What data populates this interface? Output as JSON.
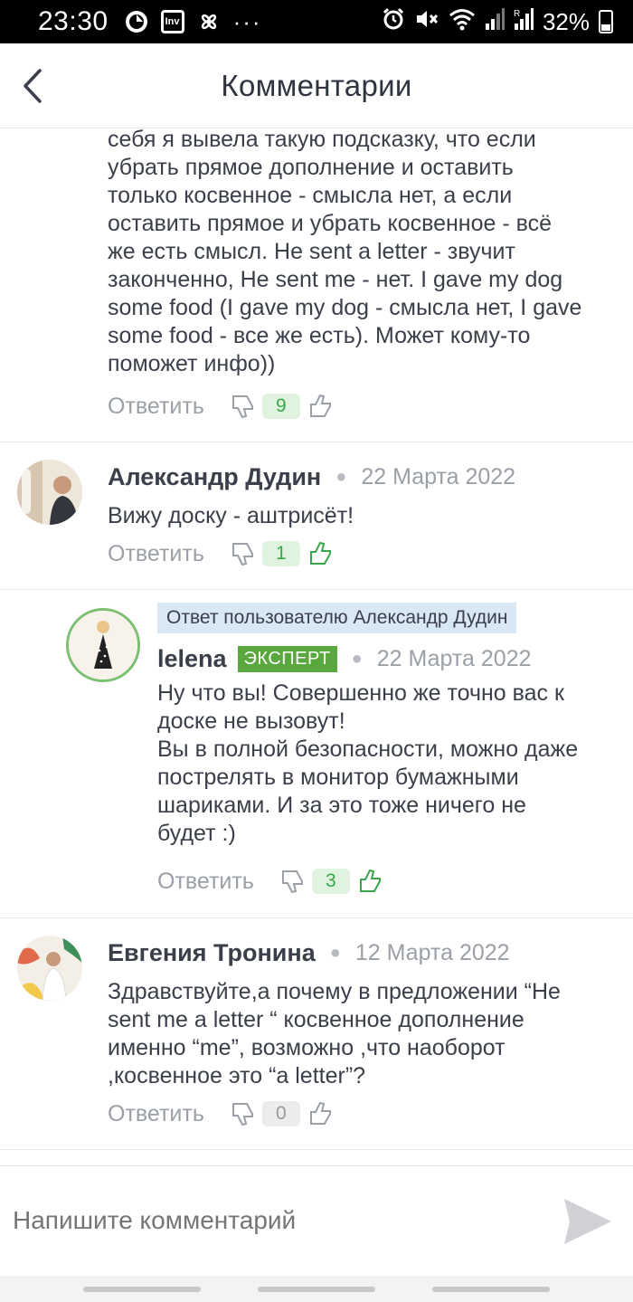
{
  "status_bar": {
    "time": "23:30",
    "battery": "32%",
    "icons_left": [
      "sync-icon",
      "inv-icon",
      "fan-icon",
      "more-icon"
    ],
    "icons_right": [
      "alarm-icon",
      "mute-icon",
      "wifi-icon",
      "signal-icon",
      "signal-roaming-icon",
      "battery-icon"
    ]
  },
  "header": {
    "title": "Комментарии",
    "back_icon": "chevron-left-icon"
  },
  "comments": [
    {
      "text": "себя я вывела такую подсказку, что если убрать прямое дополнение и оставить только косвенное - смысла нет, а если оставить прямое и убрать косвенное - всё же есть смысл. He sent a letter - звучит законченно, He sent me - нет. I gave my dog some food (I gave my dog - смысла нет, I gave some food - все же есть). Может кому-то поможет инфо))",
      "lines": [
        "себя я вывела такую подсказку, что если",
        "убрать прямое дополнение и оставить",
        "только косвенное - смысла нет, а если",
        "оставить прямое и убрать косвенное - всё",
        "же есть смысл. He sent a letter - звучит",
        "законченно, He sent me - нет. I gave my dog",
        "some food (I gave my dog - смысла нет, I gave",
        "some food - все же есть). Может кому-то",
        "поможет инфо))"
      ],
      "reply_label": "Ответить",
      "likes": "9"
    },
    {
      "author": "Александр Дудин",
      "date": "22 Марта 2022",
      "lines": [
        "Вижу доску - аштрисёт!"
      ],
      "reply_label": "Ответить",
      "likes": "1"
    },
    {
      "reply_to": "Ответ пользователю Александр Дудин",
      "author": "lelena",
      "badge": "ЭКСПЕРТ",
      "date": "22 Марта 2022",
      "lines": [
        "Ну что вы! Совершенно же точно вас к",
        "доске не вызовут!",
        "Вы в полной безопасности, можно даже",
        "пострелять в монитор бумажными",
        "шариками. И за это тоже ничего не",
        "будет :)"
      ],
      "reply_label": "Ответить",
      "likes": "3"
    },
    {
      "author": "Евгения Тронина",
      "date": "12 Марта 2022",
      "lines": [
        "Здравствуйте,а почему в предложении “He",
        "sent me a letter “ косвенное дополнение",
        "именно “me”, возможно ,что наоборот",
        ",косвенное это “a letter”?"
      ],
      "reply_label": "Ответить",
      "likes": "0"
    }
  ],
  "composer": {
    "placeholder": "Напишите комментарий",
    "send_icon": "send-icon"
  },
  "colors": {
    "accent_green": "#5aa63f",
    "like_green": "#3aa54a",
    "reply_badge": "#d9e8f5"
  }
}
